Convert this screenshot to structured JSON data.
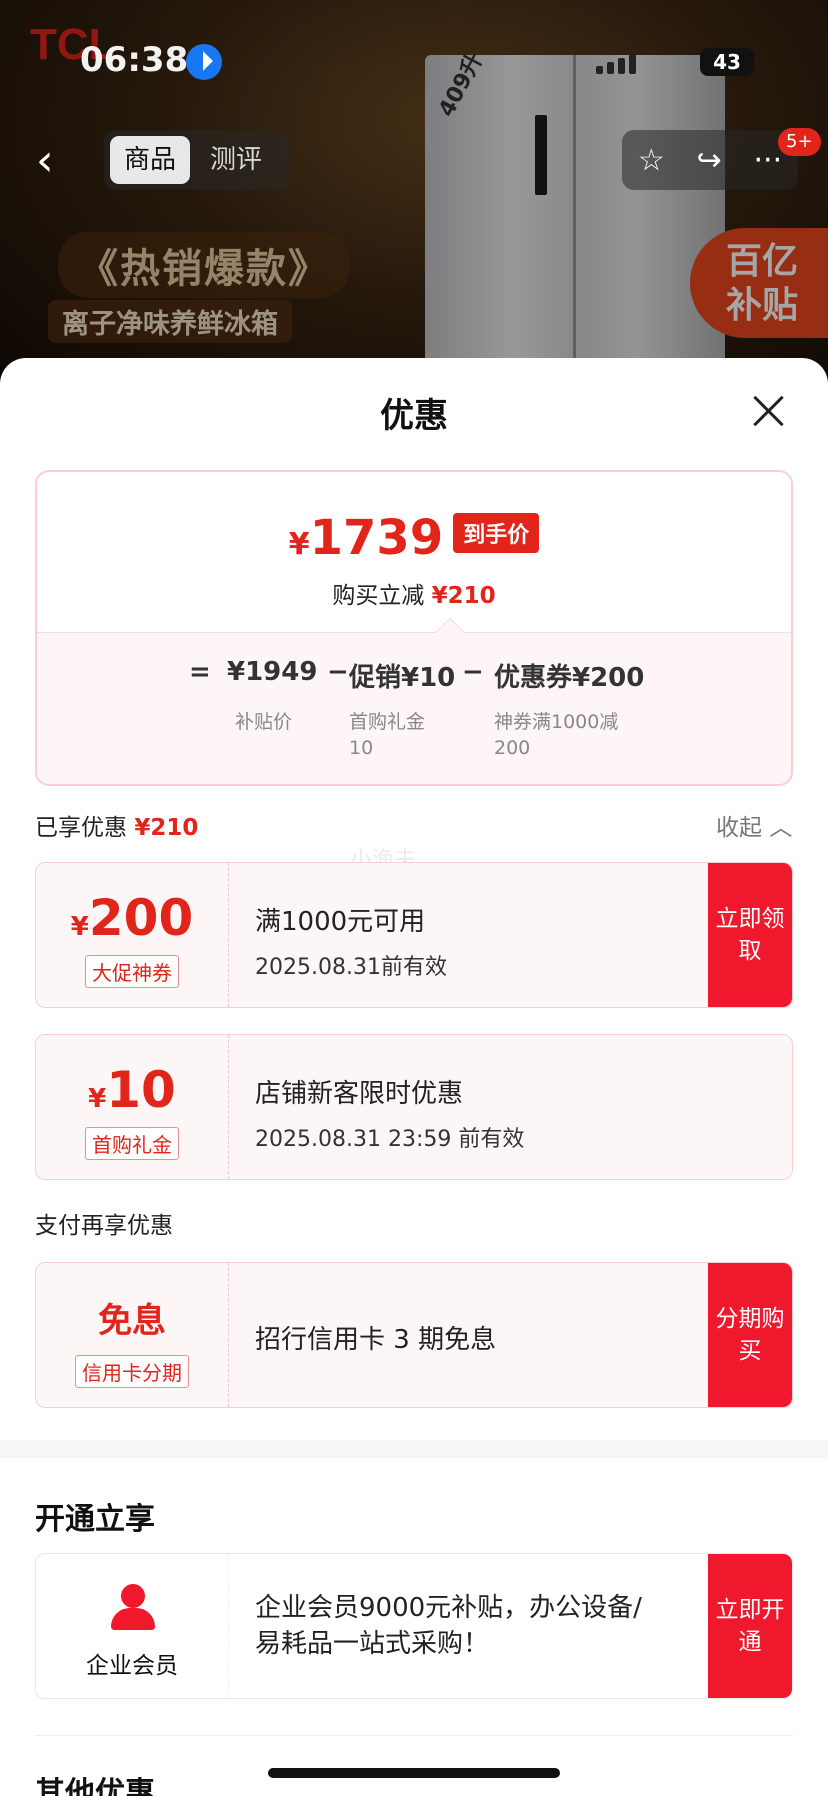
{
  "status_bar": {
    "time": "06:38",
    "battery": "43"
  },
  "background": {
    "brand": "TCL",
    "capacity": "409升",
    "promo_title": "《热销爆款》",
    "promo_subtitle": "离子净味养鲜冰箱",
    "subsidy_line1": "百亿",
    "subsidy_line2": "补贴"
  },
  "nav": {
    "back": "‹",
    "tabs": [
      {
        "label": "商品"
      },
      {
        "label": "测评"
      }
    ],
    "more": "···",
    "notification_badge": "5+"
  },
  "sheet": {
    "title": "优惠",
    "price_card": {
      "currency": "¥",
      "final_price": "1739",
      "final_tag": "到手价",
      "reduce_label": "购买立减",
      "reduce_value": "¥210",
      "breakdown": {
        "equals": "=",
        "base": "¥1949",
        "base_label": "补贴价",
        "minus": "−",
        "promo": "促销¥10",
        "promo_label": "首购礼金",
        "promo_label_value": "10",
        "coupon": "优惠券¥200",
        "coupon_label": "神券满1000减",
        "coupon_label_value": "200"
      }
    },
    "enjoyed": {
      "label": "已享优惠",
      "value": "¥210",
      "collapse": "收起"
    },
    "coupons": [
      {
        "currency": "¥",
        "amount": "200",
        "tag": "大促神券",
        "title": "满1000元可用",
        "subtitle": "2025.08.31前有效",
        "button": "立即领取"
      },
      {
        "currency": "¥",
        "amount": "10",
        "tag": "首购礼金",
        "title": "店铺新客限时优惠",
        "subtitle": "2025.08.31 23:59 前有效"
      }
    ],
    "pay_section": {
      "title": "支付再享优惠",
      "card": {
        "amount": "免息",
        "tag": "信用卡分期",
        "title": "招行信用卡 3 期免息",
        "button": "分期购买"
      }
    },
    "open_section": {
      "title": "开通立享",
      "card": {
        "label": "企业会员",
        "text": "企业会员9000元补贴，办公设备/易耗品一站式采购！",
        "button": "立即开通"
      }
    },
    "other_section": {
      "title": "其他优惠"
    },
    "watermark": "小渔夫"
  },
  "colors": {
    "accent": "#e1251b",
    "button_red": "#f0182c",
    "card_border": "#f6cfd3",
    "card_bg": "#fdf6f7"
  }
}
